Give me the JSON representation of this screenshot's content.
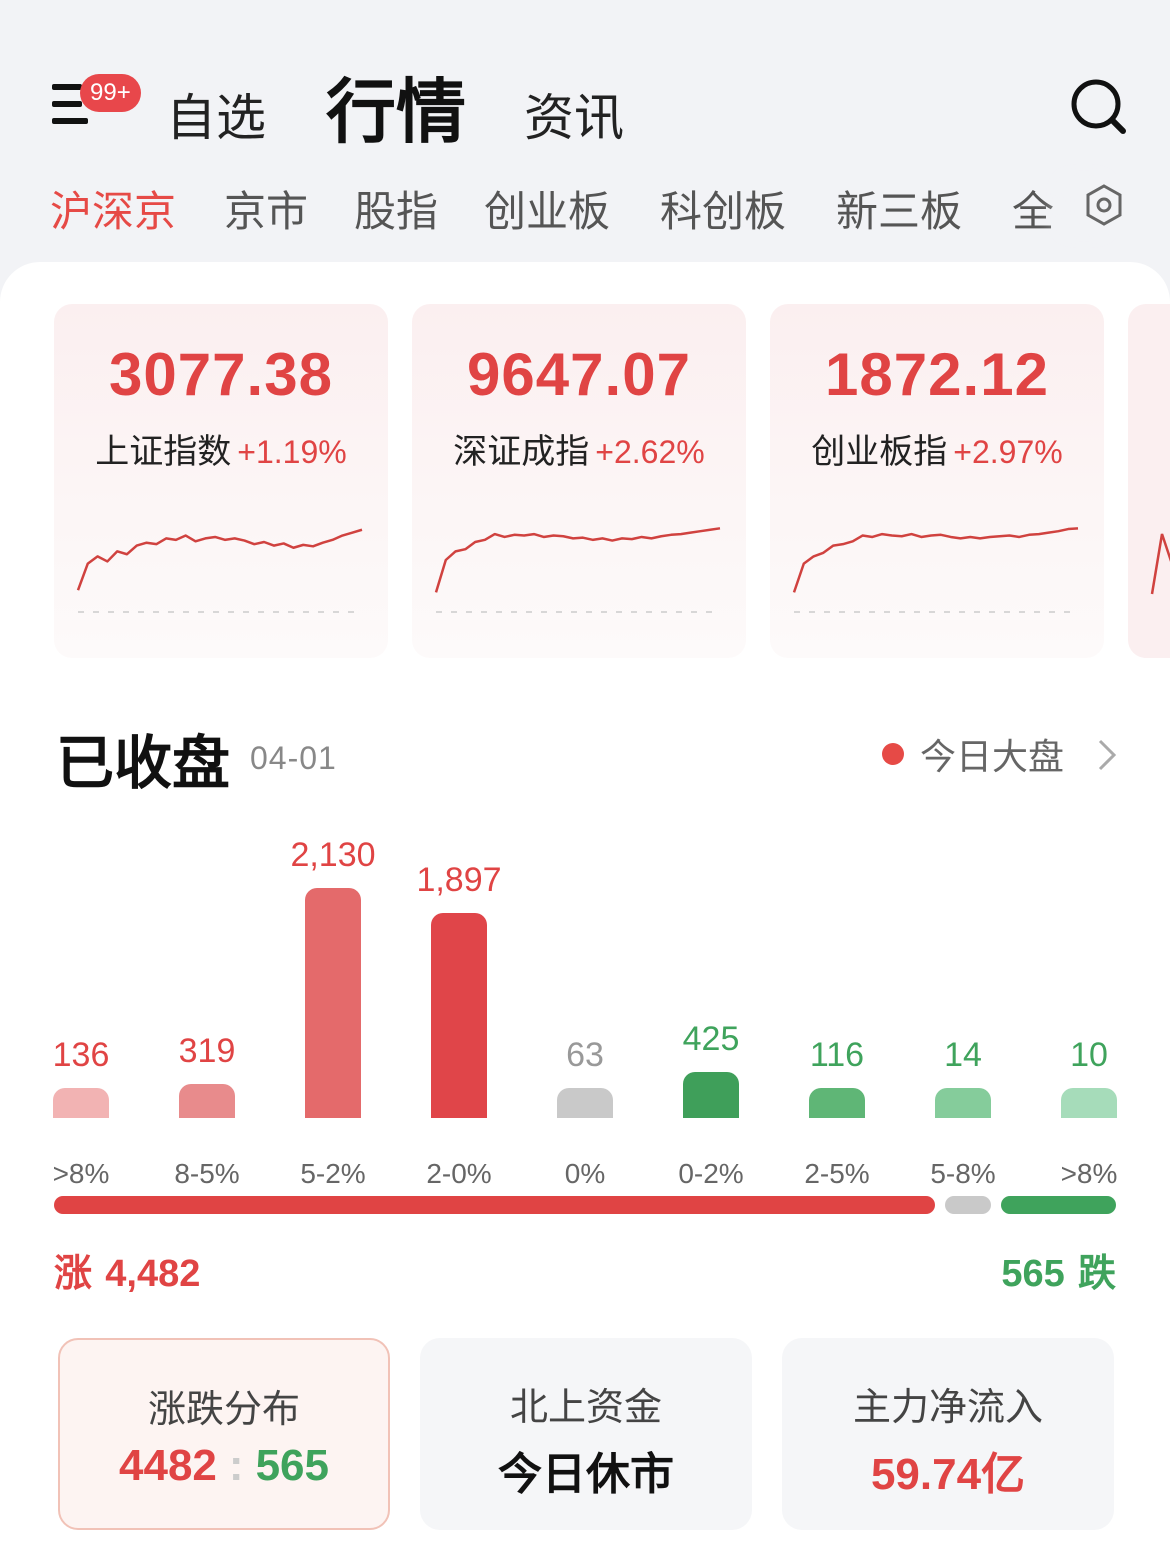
{
  "header": {
    "badge": "99+",
    "tabs": [
      "自选",
      "行情",
      "资讯"
    ],
    "active_tab": "行情"
  },
  "subtabs": {
    "items": [
      "沪深京",
      "京市",
      "股指",
      "创业板",
      "科创板",
      "新三板",
      "全"
    ],
    "active": "沪深京"
  },
  "indices": [
    {
      "value": "3077.38",
      "name": "上证指数",
      "change": "+1.19%",
      "trend": [
        0.08,
        0.45,
        0.55,
        0.48,
        0.62,
        0.58,
        0.7,
        0.74,
        0.72,
        0.8,
        0.78,
        0.84,
        0.76,
        0.8,
        0.82,
        0.78,
        0.8,
        0.77,
        0.72,
        0.75,
        0.7,
        0.73,
        0.67,
        0.71,
        0.69,
        0.74,
        0.78,
        0.84,
        0.88,
        0.92
      ]
    },
    {
      "value": "9647.07",
      "name": "深证成指",
      "change": "+2.62%",
      "trend": [
        0.05,
        0.5,
        0.62,
        0.65,
        0.75,
        0.78,
        0.86,
        0.82,
        0.85,
        0.84,
        0.86,
        0.82,
        0.84,
        0.83,
        0.8,
        0.81,
        0.78,
        0.8,
        0.77,
        0.8,
        0.79,
        0.82,
        0.8,
        0.83,
        0.85,
        0.86,
        0.88,
        0.9,
        0.92,
        0.94
      ]
    },
    {
      "value": "1872.12",
      "name": "创业板指",
      "change": "+2.97%",
      "trend": [
        0.05,
        0.45,
        0.55,
        0.6,
        0.7,
        0.72,
        0.76,
        0.84,
        0.82,
        0.86,
        0.84,
        0.83,
        0.86,
        0.82,
        0.84,
        0.85,
        0.82,
        0.8,
        0.82,
        0.8,
        0.82,
        0.83,
        0.84,
        0.82,
        0.85,
        0.86,
        0.88,
        0.9,
        0.93,
        0.94
      ]
    }
  ],
  "market": {
    "status": "已收盘",
    "date": "04-01",
    "link_label": "今日大盘"
  },
  "chart_data": {
    "type": "bar",
    "categories": [
      ">8%",
      "8-5%",
      "5-2%",
      "2-0%",
      "0%",
      "0-2%",
      "2-5%",
      "5-8%",
      ">8%"
    ],
    "values": [
      136,
      319,
      2130,
      1897,
      63,
      425,
      116,
      14,
      10
    ],
    "labels": [
      "136",
      "319",
      "2,130",
      "1,897",
      "63",
      "425",
      "116",
      "14",
      "10"
    ],
    "colors": [
      "#f2b3b3",
      "#e88b8c",
      "#e46a6b",
      "#e04549",
      "#c9c9c9",
      "#3f9f5a",
      "#5fb676",
      "#85cc9b",
      "#a6dcba"
    ],
    "value_colors": [
      "#e04444",
      "#e04444",
      "#e04444",
      "#e04444",
      "#999999",
      "#3fa35c",
      "#3fa35c",
      "#3fa35c",
      "#3fa35c"
    ]
  },
  "totals": {
    "rise_label": "涨",
    "rise": "4,482",
    "rise_value": 4482,
    "flat_value": 63,
    "fall_value": 565,
    "fall": "565",
    "fall_label": "跌"
  },
  "stats": [
    {
      "label": "涨跌分布",
      "rise": "4482",
      "sep": ":",
      "fall": "565"
    },
    {
      "label": "北上资金",
      "value": "今日休市"
    },
    {
      "label": "主力净流入",
      "value": "59.74亿"
    }
  ],
  "colors": {
    "red": "#e04444",
    "green": "#3fa35c",
    "gray": "#c9c9c9"
  }
}
